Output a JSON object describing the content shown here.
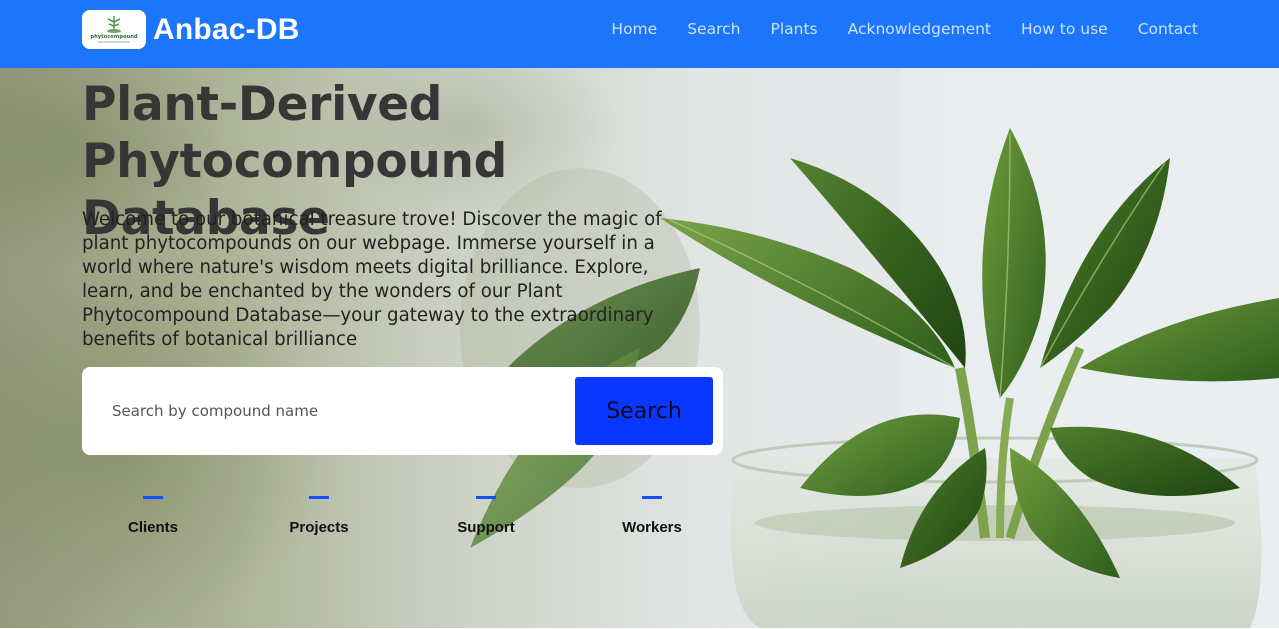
{
  "header": {
    "brand": "Anbac-DB",
    "logo_text": "phytocompound",
    "nav": [
      {
        "label": "Home"
      },
      {
        "label": "Search"
      },
      {
        "label": "Plants"
      },
      {
        "label": "Acknowledgement"
      },
      {
        "label": "How to use"
      },
      {
        "label": "Contact"
      }
    ],
    "colors": {
      "background": "#1b76fb",
      "text": "#ffffff"
    }
  },
  "hero": {
    "title_line1": "Plant-Derived",
    "title_line2": "Phytocompound Database",
    "description": "Welcome to our botanical treasure trove! Discover the magic of plant phytocompounds on our webpage. Immerse yourself in a world where nature's wisdom meets digital brilliance. Explore, learn, and be enchanted by the wonders of our Plant Phytocompound Database—your gateway to the extraordinary benefits of botanical brilliance",
    "background_image": "leafy-plant-in-glass-pot"
  },
  "search": {
    "placeholder": "Search by compound name",
    "value": "",
    "button_label": "Search",
    "button_color": "#0a37ff"
  },
  "stats": [
    {
      "label": "Clients"
    },
    {
      "label": "Projects"
    },
    {
      "label": "Support"
    },
    {
      "label": "Workers"
    }
  ]
}
